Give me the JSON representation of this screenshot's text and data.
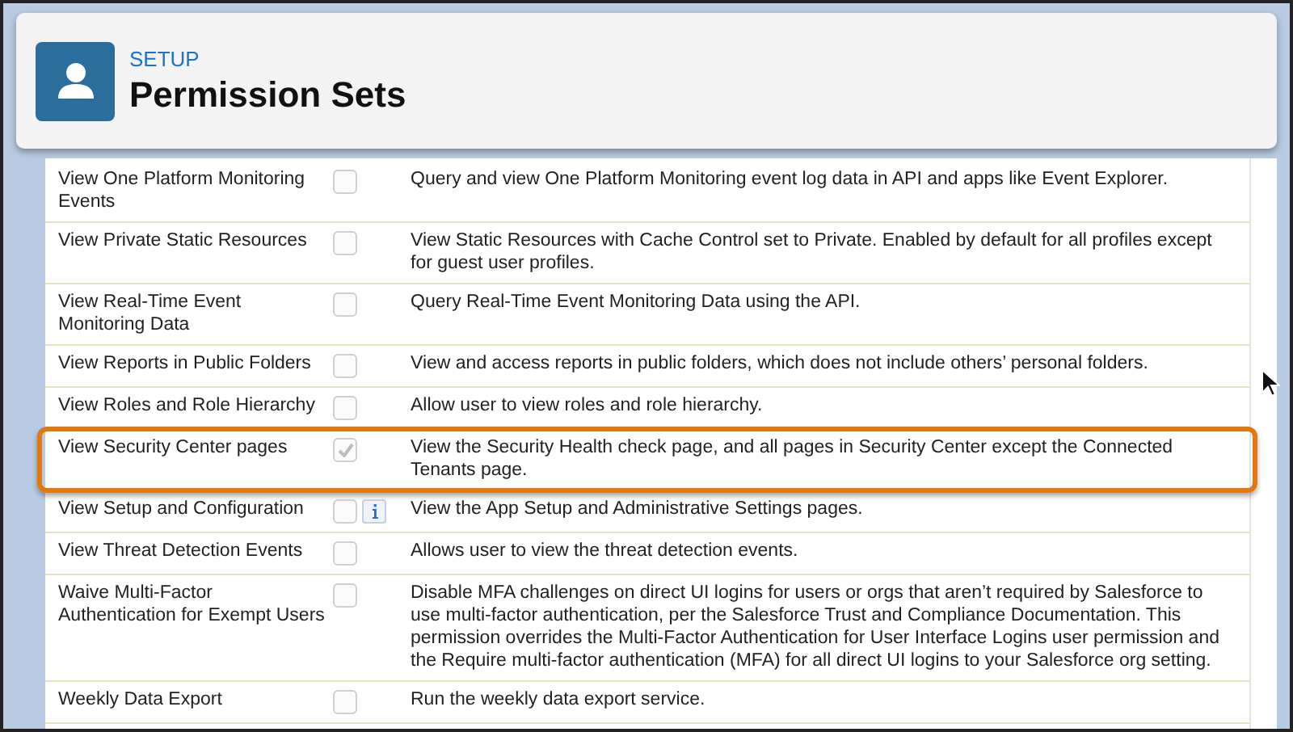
{
  "header": {
    "breadcrumb": "SETUP",
    "title": "Permission Sets"
  },
  "permissions": [
    {
      "name": "View One Platform Monitoring Events",
      "checked": false,
      "info": false,
      "highlighted": false,
      "description": "Query and view One Platform Monitoring event log data in API and apps like Event Explorer."
    },
    {
      "name": "View Private Static Resources",
      "checked": false,
      "info": false,
      "highlighted": false,
      "description": "View Static Resources with Cache Control set to Private. Enabled by default for all profiles except for guest user profiles."
    },
    {
      "name": "View Real-Time Event Monitoring Data",
      "checked": false,
      "info": false,
      "highlighted": false,
      "description": "Query Real-Time Event Monitoring Data using the API."
    },
    {
      "name": "View Reports in Public Folders",
      "checked": false,
      "info": false,
      "highlighted": false,
      "description": "View and access reports in public folders, which does not include others’ personal folders."
    },
    {
      "name": "View Roles and Role Hierarchy",
      "checked": false,
      "info": false,
      "highlighted": false,
      "description": "Allow user to view roles and role hierarchy."
    },
    {
      "name": "View Security Center pages",
      "checked": true,
      "info": false,
      "highlighted": true,
      "description": "View the Security Health check page, and all pages in Security Center except the Connected Tenants page."
    },
    {
      "name": "View Setup and Configuration",
      "checked": false,
      "info": true,
      "highlighted": false,
      "description": "View the App Setup and Administrative Settings pages."
    },
    {
      "name": "View Threat Detection Events",
      "checked": false,
      "info": false,
      "highlighted": false,
      "description": "Allows user to view the threat detection events."
    },
    {
      "name": "Waive Multi-Factor Authentication for Exempt Users",
      "checked": false,
      "info": false,
      "highlighted": false,
      "description": "Disable MFA challenges on direct UI logins for users or orgs that aren’t required by Salesforce to use multi-factor authentication, per the Salesforce Trust and Compliance Documentation. This permission overrides the Multi-Factor Authentication for User Interface Logins user permission and the Require multi-factor authentication (MFA) for all direct UI logins to your Salesforce org setting."
    },
    {
      "name": "Weekly Data Export",
      "checked": false,
      "info": false,
      "highlighted": false,
      "description": "Run the weekly data export service."
    }
  ]
}
